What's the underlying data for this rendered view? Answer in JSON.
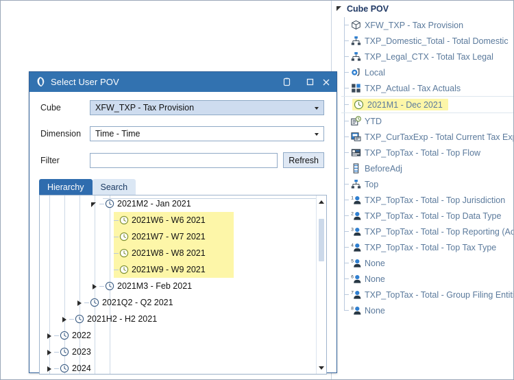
{
  "dialog": {
    "title": "Select User POV",
    "logo_icon": "onestream-logo-icon",
    "window_buttons": [
      {
        "name": "pin-icon",
        "glyph": "▯"
      },
      {
        "name": "maximize-icon",
        "glyph": "□"
      },
      {
        "name": "close-icon",
        "glyph": "✕"
      }
    ],
    "fields": {
      "cube_label": "Cube",
      "cube_value": "XFW_TXP - Tax Provision",
      "dimension_label": "Dimension",
      "dimension_value": "Time - Time",
      "filter_label": "Filter",
      "filter_value": "",
      "filter_placeholder": "",
      "refresh_label": "Refresh"
    },
    "tabs": [
      {
        "label": "Hierarchy",
        "active": true
      },
      {
        "label": "Search",
        "active": false
      }
    ],
    "tree": [
      {
        "label": "2021M2 - Jan 2021",
        "indent": 4,
        "arrow": "expanded",
        "highlight": false,
        "icon": "clock-icon"
      },
      {
        "label": "2021W6 - W6 2021",
        "indent": 5,
        "arrow": "none",
        "highlight": true,
        "icon": "clock-icon"
      },
      {
        "label": "2021W7 - W7 2021",
        "indent": 5,
        "arrow": "none",
        "highlight": true,
        "icon": "clock-icon"
      },
      {
        "label": "2021W8 - W8 2021",
        "indent": 5,
        "arrow": "none",
        "highlight": true,
        "icon": "clock-icon"
      },
      {
        "label": "2021W9 - W9 2021",
        "indent": 5,
        "arrow": "none",
        "highlight": true,
        "icon": "clock-icon"
      },
      {
        "label": "2021M3 - Feb 2021",
        "indent": 4,
        "arrow": "collapsed",
        "highlight": false,
        "icon": "clock-icon"
      },
      {
        "label": "2021Q2 - Q2 2021",
        "indent": 3,
        "arrow": "collapsed",
        "highlight": false,
        "icon": "clock-icon"
      },
      {
        "label": "2021H2 - H2 2021",
        "indent": 2,
        "arrow": "collapsed",
        "highlight": false,
        "icon": "clock-icon"
      },
      {
        "label": "2022",
        "indent": 1,
        "arrow": "collapsed",
        "highlight": false,
        "icon": "clock-icon"
      },
      {
        "label": "2023",
        "indent": 1,
        "arrow": "collapsed",
        "highlight": false,
        "icon": "clock-icon"
      },
      {
        "label": "2024",
        "indent": 1,
        "arrow": "collapsed",
        "highlight": false,
        "icon": "clock-icon"
      }
    ]
  },
  "pov": {
    "root_label": "Cube POV",
    "items": [
      {
        "label": "XFW_TXP - Tax Provision",
        "icon": "cube-icon",
        "highlight": false
      },
      {
        "label": "TXP_Domestic_Total - Total Domestic",
        "icon": "hierarchy-icon",
        "highlight": false
      },
      {
        "label": "TXP_Legal_CTX - Total Tax Legal",
        "icon": "hierarchy-icon",
        "highlight": false
      },
      {
        "label": "Local",
        "icon": "currency-icon",
        "highlight": false
      },
      {
        "label": "TXP_Actual - Tax Actuals",
        "icon": "scenario-icon",
        "highlight": false
      },
      {
        "label": "2021M1 - Dec 2021",
        "icon": "clock-icon",
        "highlight": true
      },
      {
        "label": "YTD",
        "icon": "view-icon",
        "highlight": false
      },
      {
        "label": "TXP_CurTaxExp - Total Current Tax Expen",
        "icon": "account-icon",
        "highlight": false
      },
      {
        "label": "TXP_TopTax - Total - Top Flow",
        "icon": "flow-icon",
        "highlight": false
      },
      {
        "label": "BeforeAdj",
        "icon": "origin-icon",
        "highlight": false
      },
      {
        "label": "Top",
        "icon": "hierarchy-icon",
        "highlight": false
      },
      {
        "label": "TXP_TopTax - Total - Top Jurisdiction",
        "icon": "ud1-icon",
        "badge": "1",
        "highlight": false
      },
      {
        "label": "TXP_TopTax - Total - Top Data Type",
        "icon": "ud2-icon",
        "badge": "2",
        "highlight": false
      },
      {
        "label": "TXP_TopTax - Total - Top Reporting (Acc",
        "icon": "ud3-icon",
        "badge": "3",
        "highlight": false
      },
      {
        "label": "TXP_TopTax - Total - Top Tax Type",
        "icon": "ud4-icon",
        "badge": "4",
        "highlight": false
      },
      {
        "label": "None",
        "icon": "ud5-icon",
        "badge": "5",
        "highlight": false
      },
      {
        "label": "None",
        "icon": "ud6-icon",
        "badge": "6",
        "highlight": false
      },
      {
        "label": "TXP_TopTax - Total - Group Filing Entitie",
        "icon": "ud7-icon",
        "badge": "7",
        "highlight": false
      },
      {
        "label": "None",
        "icon": "ud8-icon",
        "badge": "8",
        "highlight": false
      }
    ]
  },
  "colors": {
    "title_bar": "#3272b0",
    "tab_active": "#2f6cae",
    "highlight": "#fdf6a8",
    "pov_text": "#5b7a9c",
    "combo_fill": "#cedcef"
  }
}
